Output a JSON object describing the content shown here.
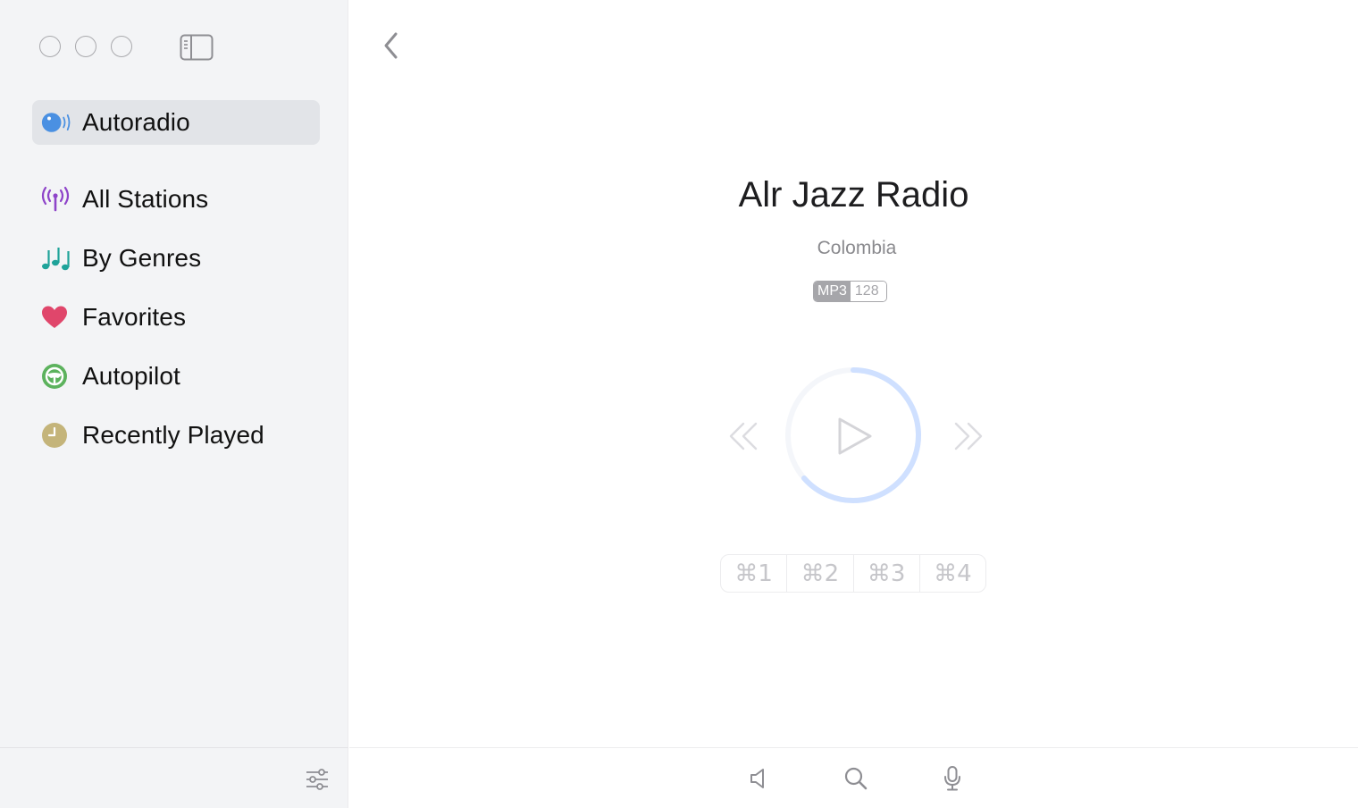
{
  "sidebar": {
    "items": [
      {
        "label": "Autoradio",
        "icon": "autoradio-icon",
        "active": true
      },
      {
        "label": "All Stations",
        "icon": "antenna-icon"
      },
      {
        "label": "By Genres",
        "icon": "music-notes-icon"
      },
      {
        "label": "Favorites",
        "icon": "heart-icon"
      },
      {
        "label": "Autopilot",
        "icon": "steering-wheel-icon"
      },
      {
        "label": "Recently Played",
        "icon": "clock-icon"
      }
    ],
    "footer_icon": "sliders-icon"
  },
  "player": {
    "title": "Alr Jazz Radio",
    "country": "Colombia",
    "format": "MP3",
    "bitrate": "128",
    "shortcuts": [
      "⌘1",
      "⌘2",
      "⌘3",
      "⌘4"
    ]
  },
  "toolbar": {
    "icons": [
      "speaker-icon",
      "search-icon",
      "microphone-icon"
    ]
  },
  "colors": {
    "autoradio": "#4a90e2",
    "all_stations": "#8e44c9",
    "genres": "#1fa39a",
    "favorites": "#e0466b",
    "autopilot": "#5cb25d",
    "recently_played": "#c4b47a",
    "spinner": "#cfe0ff"
  }
}
